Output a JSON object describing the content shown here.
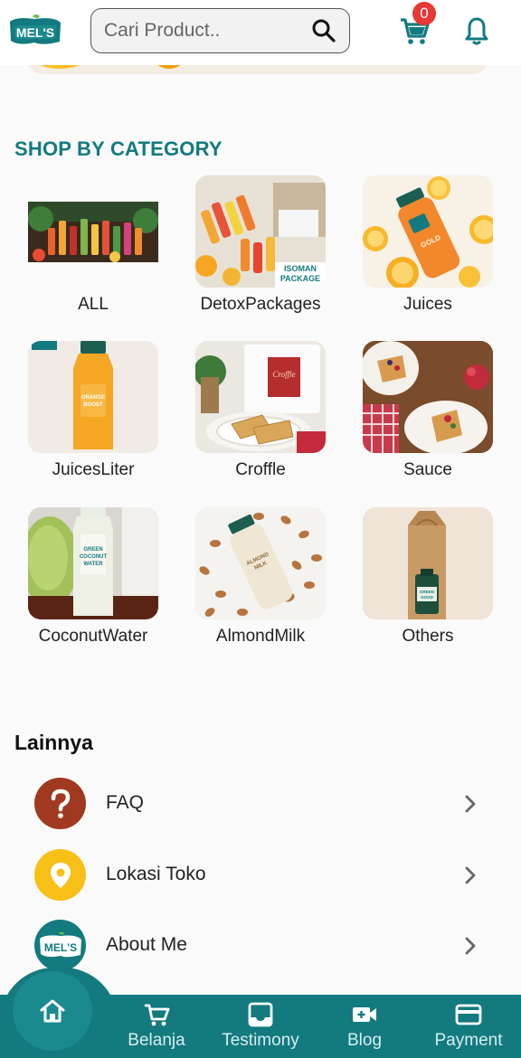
{
  "header": {
    "logo_text": "MEL'S",
    "search_placeholder": "Cari Product..",
    "cart_count": "0"
  },
  "section_title": "SHOP BY CATEGORY",
  "categories": [
    {
      "label": "ALL"
    },
    {
      "label": "DetoxPackages"
    },
    {
      "label": "Juices"
    },
    {
      "label": "JuicesLiter"
    },
    {
      "label": "Croffle"
    },
    {
      "label": "Sauce"
    },
    {
      "label": "CoconutWater"
    },
    {
      "label": "AlmondMilk"
    },
    {
      "label": "Others"
    }
  ],
  "lainnya": {
    "title": "Lainnya",
    "items": [
      {
        "label": "FAQ",
        "icon": "question-icon",
        "color": "#a0391f"
      },
      {
        "label": "Lokasi Toko",
        "icon": "location-pin-icon",
        "color": "#f8bf16"
      },
      {
        "label": "About Me",
        "icon": "mels-logo-icon",
        "color": "#137a7f"
      }
    ]
  },
  "bottom_nav": {
    "items": [
      {
        "label": "Belanja",
        "icon": "cart-icon"
      },
      {
        "label": "Testimony",
        "icon": "inbox-icon"
      },
      {
        "label": "Blog",
        "icon": "video-icon"
      },
      {
        "label": "Payment",
        "icon": "card-icon"
      }
    ]
  },
  "colors": {
    "brand": "#137a7f",
    "badge": "#e53935"
  }
}
